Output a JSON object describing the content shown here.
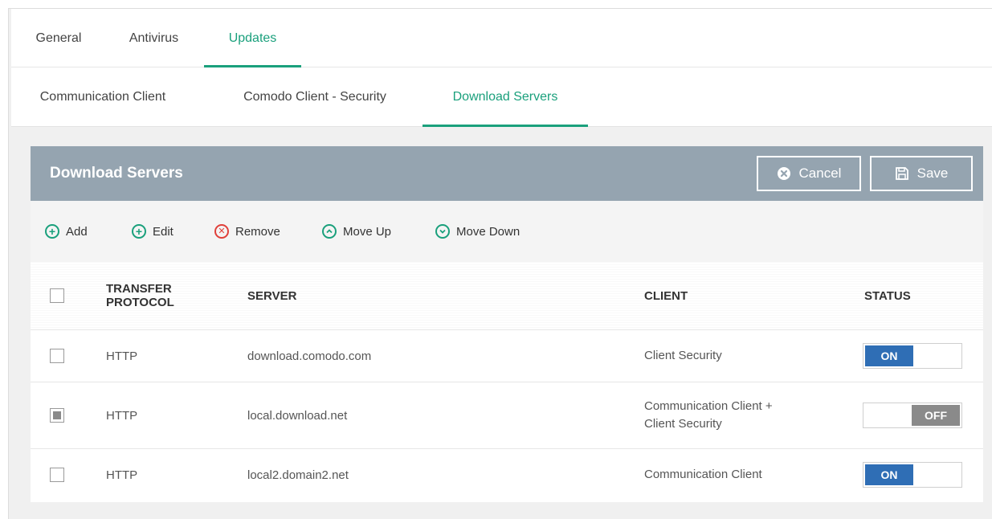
{
  "tabs": [
    {
      "label": "General",
      "active": false
    },
    {
      "label": "Antivirus",
      "active": false
    },
    {
      "label": "Updates",
      "active": true
    }
  ],
  "subtabs": [
    {
      "label": "Communication Client",
      "active": false
    },
    {
      "label": "Comodo Client - Security",
      "active": false
    },
    {
      "label": "Download Servers",
      "active": true
    }
  ],
  "panel": {
    "title": "Download Servers",
    "cancel_label": "Cancel",
    "save_label": "Save"
  },
  "toolbar": {
    "add": "Add",
    "edit": "Edit",
    "remove": "Remove",
    "move_up": "Move Up",
    "move_down": "Move Down"
  },
  "table": {
    "headers": {
      "protocol_line1": "TRANSFER",
      "protocol_line2": "PROTOCOL",
      "server": "SERVER",
      "client": "CLIENT",
      "status": "STATUS"
    },
    "rows": [
      {
        "protocol": "HTTP",
        "server": "download.comodo.com",
        "client_line1": "Client Security",
        "client_line2": "",
        "status": "ON",
        "checked": false
      },
      {
        "protocol": "HTTP",
        "server": "local.download.net",
        "client_line1": "Communication Client +",
        "client_line2": "Client Security",
        "status": "OFF",
        "checked": "partial"
      },
      {
        "protocol": "HTTP",
        "server": "local2.domain2.net",
        "client_line1": "Communication Client",
        "client_line2": "",
        "status": "ON",
        "checked": false
      }
    ]
  },
  "colors": {
    "accent": "#1aa07c",
    "header_bg": "#95a4b0",
    "toggle_on": "#2f6eb5",
    "toggle_off": "#8a8a8a",
    "remove_red": "#e0403a"
  },
  "icons": {
    "add": "plus-circle-icon",
    "edit": "plus-circle-icon",
    "remove": "x-circle-icon",
    "move_up": "chevron-up-circle-icon",
    "move_down": "chevron-down-circle-icon",
    "cancel": "x-circle-filled-icon",
    "save": "floppy-disk-icon"
  }
}
